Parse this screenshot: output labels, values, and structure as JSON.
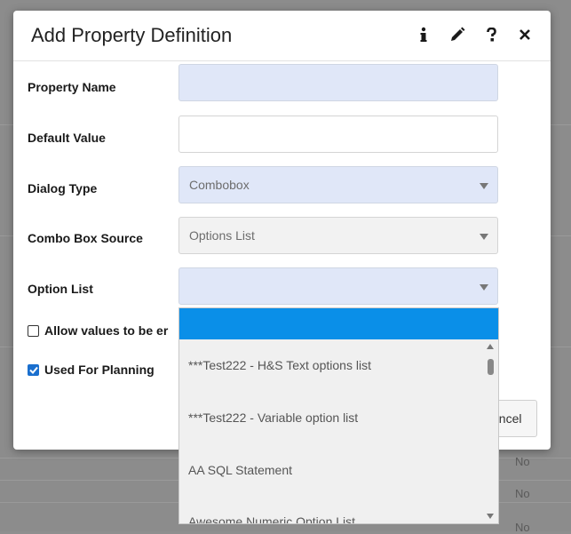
{
  "dialog": {
    "title": "Add Property Definition",
    "icons": [
      "info-icon",
      "pencil-icon",
      "help-icon",
      "close-icon"
    ]
  },
  "form": {
    "property_name": {
      "label": "Property Name",
      "value": ""
    },
    "default_value": {
      "label": "Default Value",
      "value": ""
    },
    "dialog_type": {
      "label": "Dialog Type",
      "value": "Combobox"
    },
    "combo_box_source": {
      "label": "Combo Box Source",
      "value": "Options List"
    },
    "option_list": {
      "label": "Option List",
      "value": ""
    }
  },
  "checkboxes": {
    "allow_values": {
      "label": "Allow values to be er",
      "checked": false
    },
    "used_for_planning": {
      "label": "Used For Planning",
      "checked": true
    }
  },
  "buttons": {
    "cancel_label": "ancel"
  },
  "dropdown": {
    "items": [
      "***Test222 - H&S Text options list",
      "***Test222 - Variable option list",
      "AA SQL Statement",
      "Awesome Numeric Option List"
    ]
  },
  "background": {
    "cells": [
      "No",
      "No",
      "No"
    ]
  },
  "colors": {
    "accent": "#0a8fe8",
    "input_bg": "#e0e7f8",
    "checkbox": "#1a6fce"
  }
}
